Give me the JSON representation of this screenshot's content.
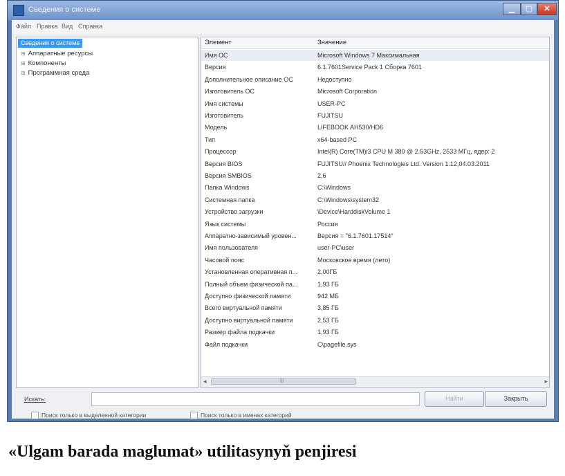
{
  "window": {
    "title": "Сведения о системе",
    "controls": {
      "minimize": "▁",
      "maximize": "▢",
      "close": "✕"
    }
  },
  "menubar": [
    {
      "label": "Файл"
    },
    {
      "label": "Правка"
    },
    {
      "label": "Вид"
    },
    {
      "label": "Справка"
    }
  ],
  "tree": {
    "root": "Сведения о системе",
    "nodes": [
      {
        "expander": "⊞",
        "label": "Аппаратные ресурсы"
      },
      {
        "expander": "⊞",
        "label": "Компоненты"
      },
      {
        "expander": "⊞",
        "label": "Программная среда"
      }
    ]
  },
  "table": {
    "headers": {
      "element": "Элемент",
      "value": "Значение"
    },
    "rows": [
      {
        "element": "Имя ОС",
        "value": "Microsoft Windows 7 Максимальная"
      },
      {
        "element": "Версия",
        "value": "6.1.7601Service Pack 1 Сборка 7601"
      },
      {
        "element": "Дополнительное описание ОС",
        "value": "Недоступно"
      },
      {
        "element": "Изготовитель ОС",
        "value": "Microsoft Corporation"
      },
      {
        "element": "Имя системы",
        "value": "USER-PC"
      },
      {
        "element": "Изготовитель",
        "value": "FUJITSU"
      },
      {
        "element": "Модель",
        "value": "LIFEBOOK AH530/HD6"
      },
      {
        "element": "Тип",
        "value": "x64-based PC"
      },
      {
        "element": "Процессор",
        "value": "Intel(R) Core(TM)i3 CPU   M 380 @ 2.53GHz, 2533 МГц, ядер: 2"
      },
      {
        "element": "Версия BIOS",
        "value": "FUJITSU// Phoenix Technologies Ltd. Version 1.12,04.03.2011"
      },
      {
        "element": "Версия SMBIOS",
        "value": "2,6"
      },
      {
        "element": "Папка Windows",
        "value": "C:\\Windows"
      },
      {
        "element": "Системная папка",
        "value": "C:\\Windows\\system32"
      },
      {
        "element": "Устройство загрузки",
        "value": "\\Device\\HarddiskVolume 1"
      },
      {
        "element": "Язык системы",
        "value": "Россия"
      },
      {
        "element": "Аппаратно-зависимый уровен...",
        "value": "Версия = \"6.1.7601.17514\""
      },
      {
        "element": "Имя пользователя",
        "value": "user-PC\\user"
      },
      {
        "element": "Часовой пояс",
        "value": "Московское время (лето)"
      },
      {
        "element": "Установленная оперативная п...",
        "value": "2,00ГБ"
      },
      {
        "element": "Полный объем физической па...",
        "value": "1,93 ГБ"
      },
      {
        "element": "Доступно физической памяти",
        "value": "942 МБ"
      },
      {
        "element": "Всего виртуальной памяти",
        "value": "3,85 ГБ"
      },
      {
        "element": "Доступно виртуальной памяти",
        "value": "2,53 ГБ"
      },
      {
        "element": "Размер файла подкачки",
        "value": "1,93 ГБ"
      },
      {
        "element": "Файл подкачки",
        "value": "C\\pagefile.sys"
      }
    ]
  },
  "scrollbar": {
    "left_arrow": "◂",
    "right_arrow": "▸",
    "grip": "|||"
  },
  "search": {
    "label": "Искать:",
    "value": ""
  },
  "buttons": {
    "find": "Найти",
    "close": "Закрыть"
  },
  "checkboxes": [
    {
      "label": "Поиск только в выделенной категории",
      "checked": false
    },
    {
      "label": "Поиск только в именах категорий",
      "checked": false
    }
  ],
  "caption": "«Ulgam barada maglumat» utilitasynyň penjiresi",
  "colors": {
    "titlebar": "#6f93c9",
    "selection": "#3399ff",
    "close_button": "#c2371d"
  }
}
